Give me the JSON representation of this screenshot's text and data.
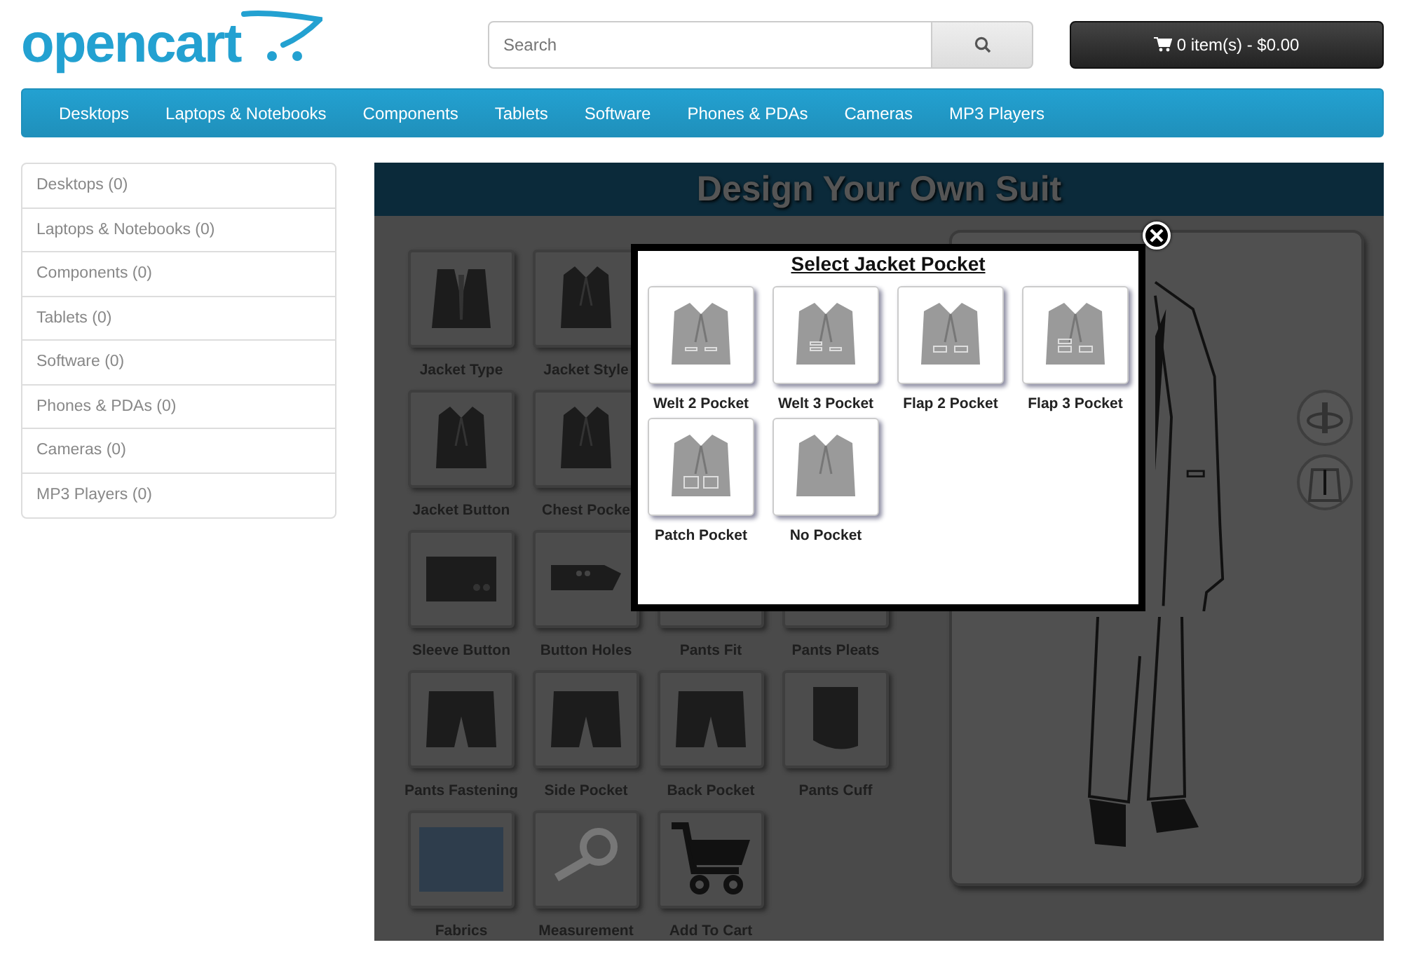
{
  "logo": {
    "text": "opencart"
  },
  "search": {
    "placeholder": "Search"
  },
  "cart": {
    "label": "0 item(s) - $0.00"
  },
  "nav": [
    "Desktops",
    "Laptops & Notebooks",
    "Components",
    "Tablets",
    "Software",
    "Phones & PDAs",
    "Cameras",
    "MP3 Players"
  ],
  "sidebar": [
    "Desktops (0)",
    "Laptops & Notebooks (0)",
    "Components (0)",
    "Tablets (0)",
    "Software (0)",
    "Phones & PDAs (0)",
    "Cameras (0)",
    "MP3 Players (0)"
  ],
  "designer": {
    "title": "Design Your Own Suit",
    "option_rows": [
      [
        {
          "label": "Jacket Type",
          "kind": "vest"
        },
        {
          "label": "Jacket Style",
          "kind": "jacket"
        }
      ],
      [
        {
          "label": "Jacket Button",
          "kind": "jacket"
        },
        {
          "label": "Chest Pocke",
          "kind": "jacket"
        }
      ],
      [
        {
          "label": "Sleeve Button",
          "kind": "sleeve"
        },
        {
          "label": "Button Holes",
          "kind": "cuffband"
        },
        {
          "label": "Pants Fit",
          "kind": "covered"
        },
        {
          "label": "Pants Pleats",
          "kind": "covered"
        }
      ],
      [
        {
          "label": "Pants Fastening",
          "kind": "pants"
        },
        {
          "label": "Side Pocket",
          "kind": "pants"
        },
        {
          "label": "Back Pocket",
          "kind": "pants"
        },
        {
          "label": "Pants Cuff",
          "kind": "cuff"
        }
      ],
      [
        {
          "label": "Fabrics",
          "kind": "fabric"
        },
        {
          "label": "Measurement",
          "kind": "tape"
        },
        {
          "label": "Add To Cart",
          "kind": "cart"
        }
      ]
    ]
  },
  "modal": {
    "title": "Select Jacket Pocket",
    "choices": [
      {
        "label": "Welt 2 Pocket",
        "kind": "welt2"
      },
      {
        "label": "Welt 3 Pocket",
        "kind": "welt3"
      },
      {
        "label": "Flap 2 Pocket",
        "kind": "flap2"
      },
      {
        "label": "Flap 3 Pocket",
        "kind": "flap3"
      },
      {
        "label": "Patch Pocket",
        "kind": "patch"
      },
      {
        "label": "No Pocket",
        "kind": "none"
      }
    ]
  }
}
